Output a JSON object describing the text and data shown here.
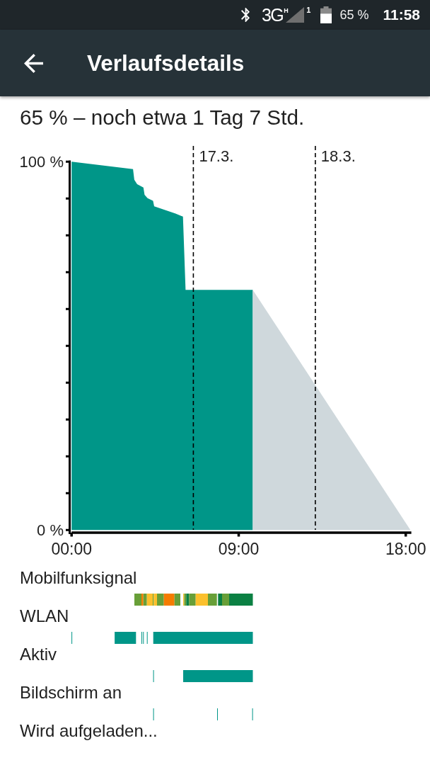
{
  "status_bar": {
    "network": "3G",
    "network_subtype": "H",
    "sim_slot": "1",
    "battery": "65 %",
    "time": "11:58"
  },
  "app_bar": {
    "title": "Verlaufsdetails"
  },
  "summary": "65 % – noch etwa 1 Tag 7 Std.",
  "chart": {
    "chart_data": {
      "type": "area",
      "x": [
        0,
        3.31,
        3.38,
        3.53,
        3.87,
        3.93,
        4.09,
        4.39,
        4.45,
        5.6,
        6.0,
        6.14,
        9.76,
        18.25
      ],
      "series": [
        {
          "color": "#009688",
          "values": [
            100,
            98,
            95.1,
            93.9,
            93,
            91,
            90.1,
            89.4,
            87.9,
            85.9,
            85.1,
            65.2,
            65.2,
            null
          ]
        },
        {
          "color": "#cfd8dc",
          "values": [
            null,
            null,
            null,
            null,
            null,
            null,
            null,
            null,
            null,
            null,
            null,
            null,
            65.2,
            0
          ]
        }
      ],
      "xlim": [
        0,
        18.3
      ],
      "ylim": [
        0,
        100
      ],
      "xticks": [
        {
          "value": 0,
          "label": "00:00"
        },
        {
          "value": 9,
          "label": "09:00"
        },
        {
          "value": 18,
          "label": "18:00"
        }
      ],
      "yticks": [
        {
          "value": 0,
          "label": "0 %"
        },
        {
          "value": 100,
          "label": "100 %"
        }
      ],
      "ref_lines": [
        {
          "axis": "x",
          "value": 6.56
        },
        {
          "axis": "x",
          "value": 13.13
        }
      ],
      "annotations": [
        {
          "x": 6.56,
          "text": "17.3."
        },
        {
          "x": 13.13,
          "text": "18.3."
        }
      ]
    }
  },
  "timelines": [
    {
      "kind": "signal",
      "label": "Mobilfunksignal"
    },
    {
      "kind": "wifi",
      "label": "WLAN"
    },
    {
      "kind": "awake",
      "label": "Aktiv"
    },
    {
      "kind": "screen",
      "label": "Bildschirm an"
    },
    {
      "kind": "charging",
      "label": "Wird aufgeladen..."
    }
  ]
}
